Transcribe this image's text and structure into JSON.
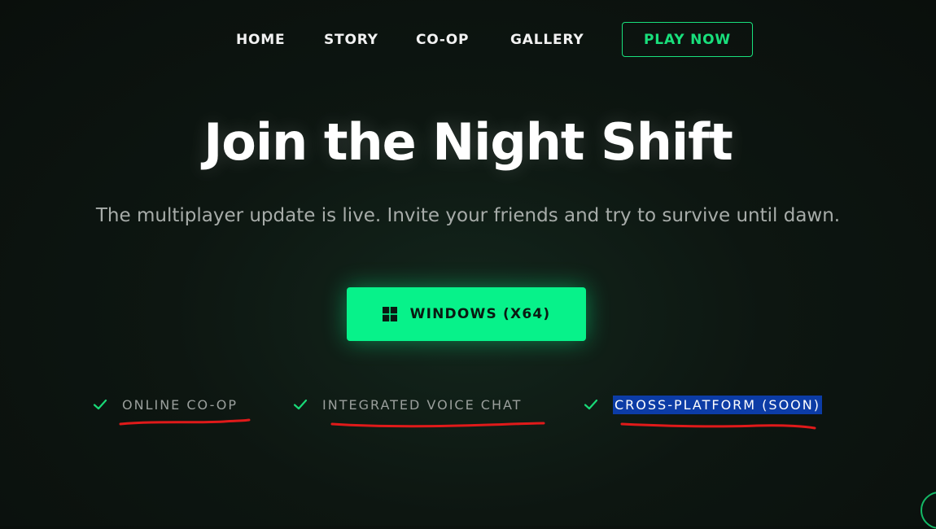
{
  "nav": {
    "items": [
      {
        "label": "HOME"
      },
      {
        "label": "STORY"
      },
      {
        "label": "CO-OP"
      },
      {
        "label": "GALLERY"
      }
    ],
    "cta_label": "PLAY NOW"
  },
  "hero": {
    "title": "Join the Night Shift",
    "subtitle": "The multiplayer update is live. Invite your friends and try to survive until dawn."
  },
  "download": {
    "label": "WINDOWS (X64)",
    "icon": "windows-icon"
  },
  "features": [
    {
      "label": "ONLINE CO-OP",
      "icon": "check-icon"
    },
    {
      "label": "INTEGRATED VOICE CHAT",
      "icon": "check-icon"
    },
    {
      "label": "CROSS-PLATFORM (SOON)",
      "icon": "check-icon",
      "selected": true
    }
  ],
  "colors": {
    "accent": "#07f28a",
    "nav_accent": "#19e07c",
    "background": "#0d1611",
    "selection": "#0c3ca6",
    "annotation": "#e01a1a"
  }
}
